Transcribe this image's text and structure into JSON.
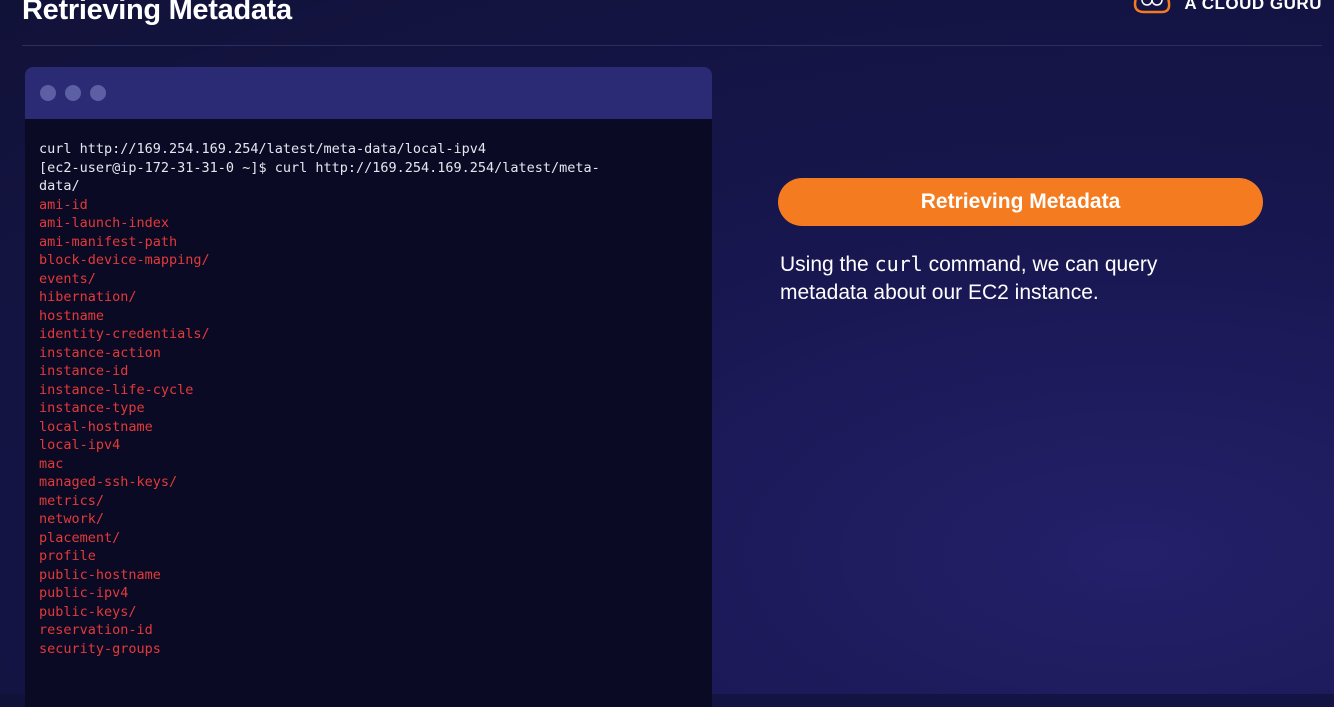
{
  "header": {
    "title": "Retrieving Metadata",
    "brand_name": "A CLOUD GURU"
  },
  "terminal": {
    "command_lines": [
      "curl http://169.254.169.254/latest/meta-data/local-ipv4",
      "[ec2-user@ip-172-31-31-0 ~]$ curl http://169.254.169.254/latest/meta-data/"
    ],
    "output_lines": [
      "ami-id",
      "ami-launch-index",
      "ami-manifest-path",
      "block-device-mapping/",
      "events/",
      "hibernation/",
      "hostname",
      "identity-credentials/",
      "instance-action",
      "instance-id",
      "instance-life-cycle",
      "instance-type",
      "local-hostname",
      "local-ipv4",
      "mac",
      "managed-ssh-keys/",
      "metrics/",
      "network/",
      "placement/",
      "profile",
      "public-hostname",
      "public-ipv4",
      "public-keys/",
      "reservation-id",
      "security-groups"
    ]
  },
  "panel": {
    "heading": "Retrieving Metadata",
    "description_before": "Using the ",
    "description_code": "curl",
    "description_after": " command, we can query metadata about our EC2 instance."
  },
  "colors": {
    "accent": "#f47b20",
    "terminal_output": "#e23a3a",
    "terminal_bg": "#0b0a24",
    "titlebar": "#2b2b75"
  },
  "icons": {
    "brand": "cloud-guru-logo-icon"
  }
}
